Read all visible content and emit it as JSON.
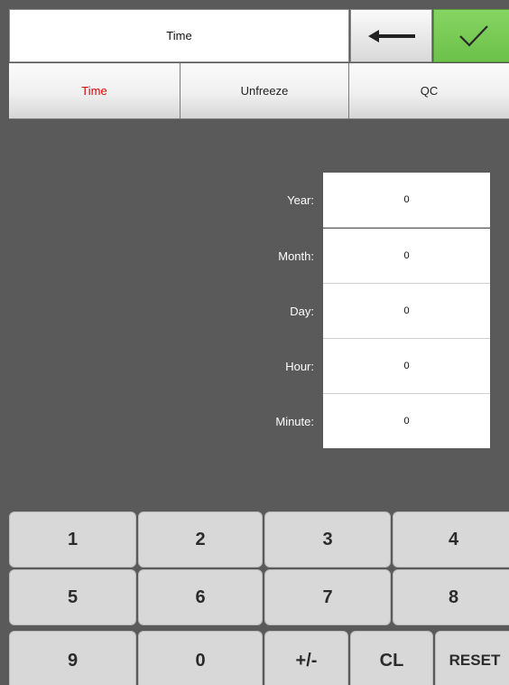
{
  "header": {
    "title": "Time",
    "back_icon": "arrow-left-icon",
    "ok_icon": "checkmark-icon",
    "ok_color": "#78c85a"
  },
  "tabs": [
    {
      "label": "Time",
      "active": true
    },
    {
      "label": "Unfreeze",
      "active": false
    },
    {
      "label": "QC",
      "active": false
    }
  ],
  "form": {
    "fields": [
      {
        "label": "Year:",
        "value": "0"
      },
      {
        "label": "Month:",
        "value": "0"
      },
      {
        "label": "Day:",
        "value": "0"
      },
      {
        "label": "Hour:",
        "value": "0"
      },
      {
        "label": "Minute:",
        "value": "0"
      }
    ]
  },
  "keypad": {
    "row1": [
      "1",
      "2",
      "3",
      "4"
    ],
    "row2": [
      "5",
      "6",
      "7",
      "8"
    ],
    "row3": [
      "9",
      "0",
      "+/-",
      "CL",
      "RESET"
    ]
  },
  "colors": {
    "background": "#5a5a5a",
    "active_tab_text": "#e00000",
    "key_face": "#d8d8d8"
  }
}
